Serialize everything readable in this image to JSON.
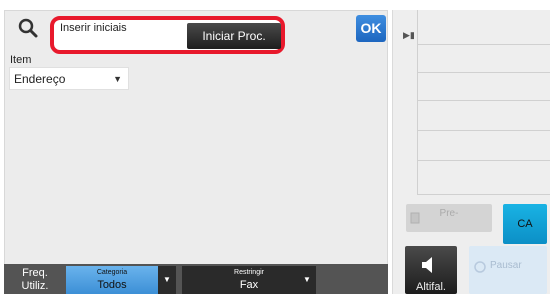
{
  "search": {
    "placeholder": "Inserir iniciais",
    "start_button": "Iniciar Proc.",
    "ok_button": "OK"
  },
  "item": {
    "label": "Item",
    "selected": "Endereço"
  },
  "bottom": {
    "freq_label": "Freq. Utiliz.",
    "category_label": "Categoria",
    "category_value": "Todos",
    "restrict_label": "Restringir",
    "restrict_value": "Fax"
  },
  "right": {
    "pre_button": "Pre-",
    "ca_button": "CA",
    "speaker_label": "Altifal.",
    "blank_label": "Pausar"
  },
  "colors": {
    "highlight": "#e8192c",
    "ok": "#2a78d2",
    "category": "#55a4e6",
    "ca": "#14a5d8"
  },
  "icons": [
    "search-icon",
    "chevron-down-icon",
    "play-icon",
    "speaker-icon"
  ]
}
